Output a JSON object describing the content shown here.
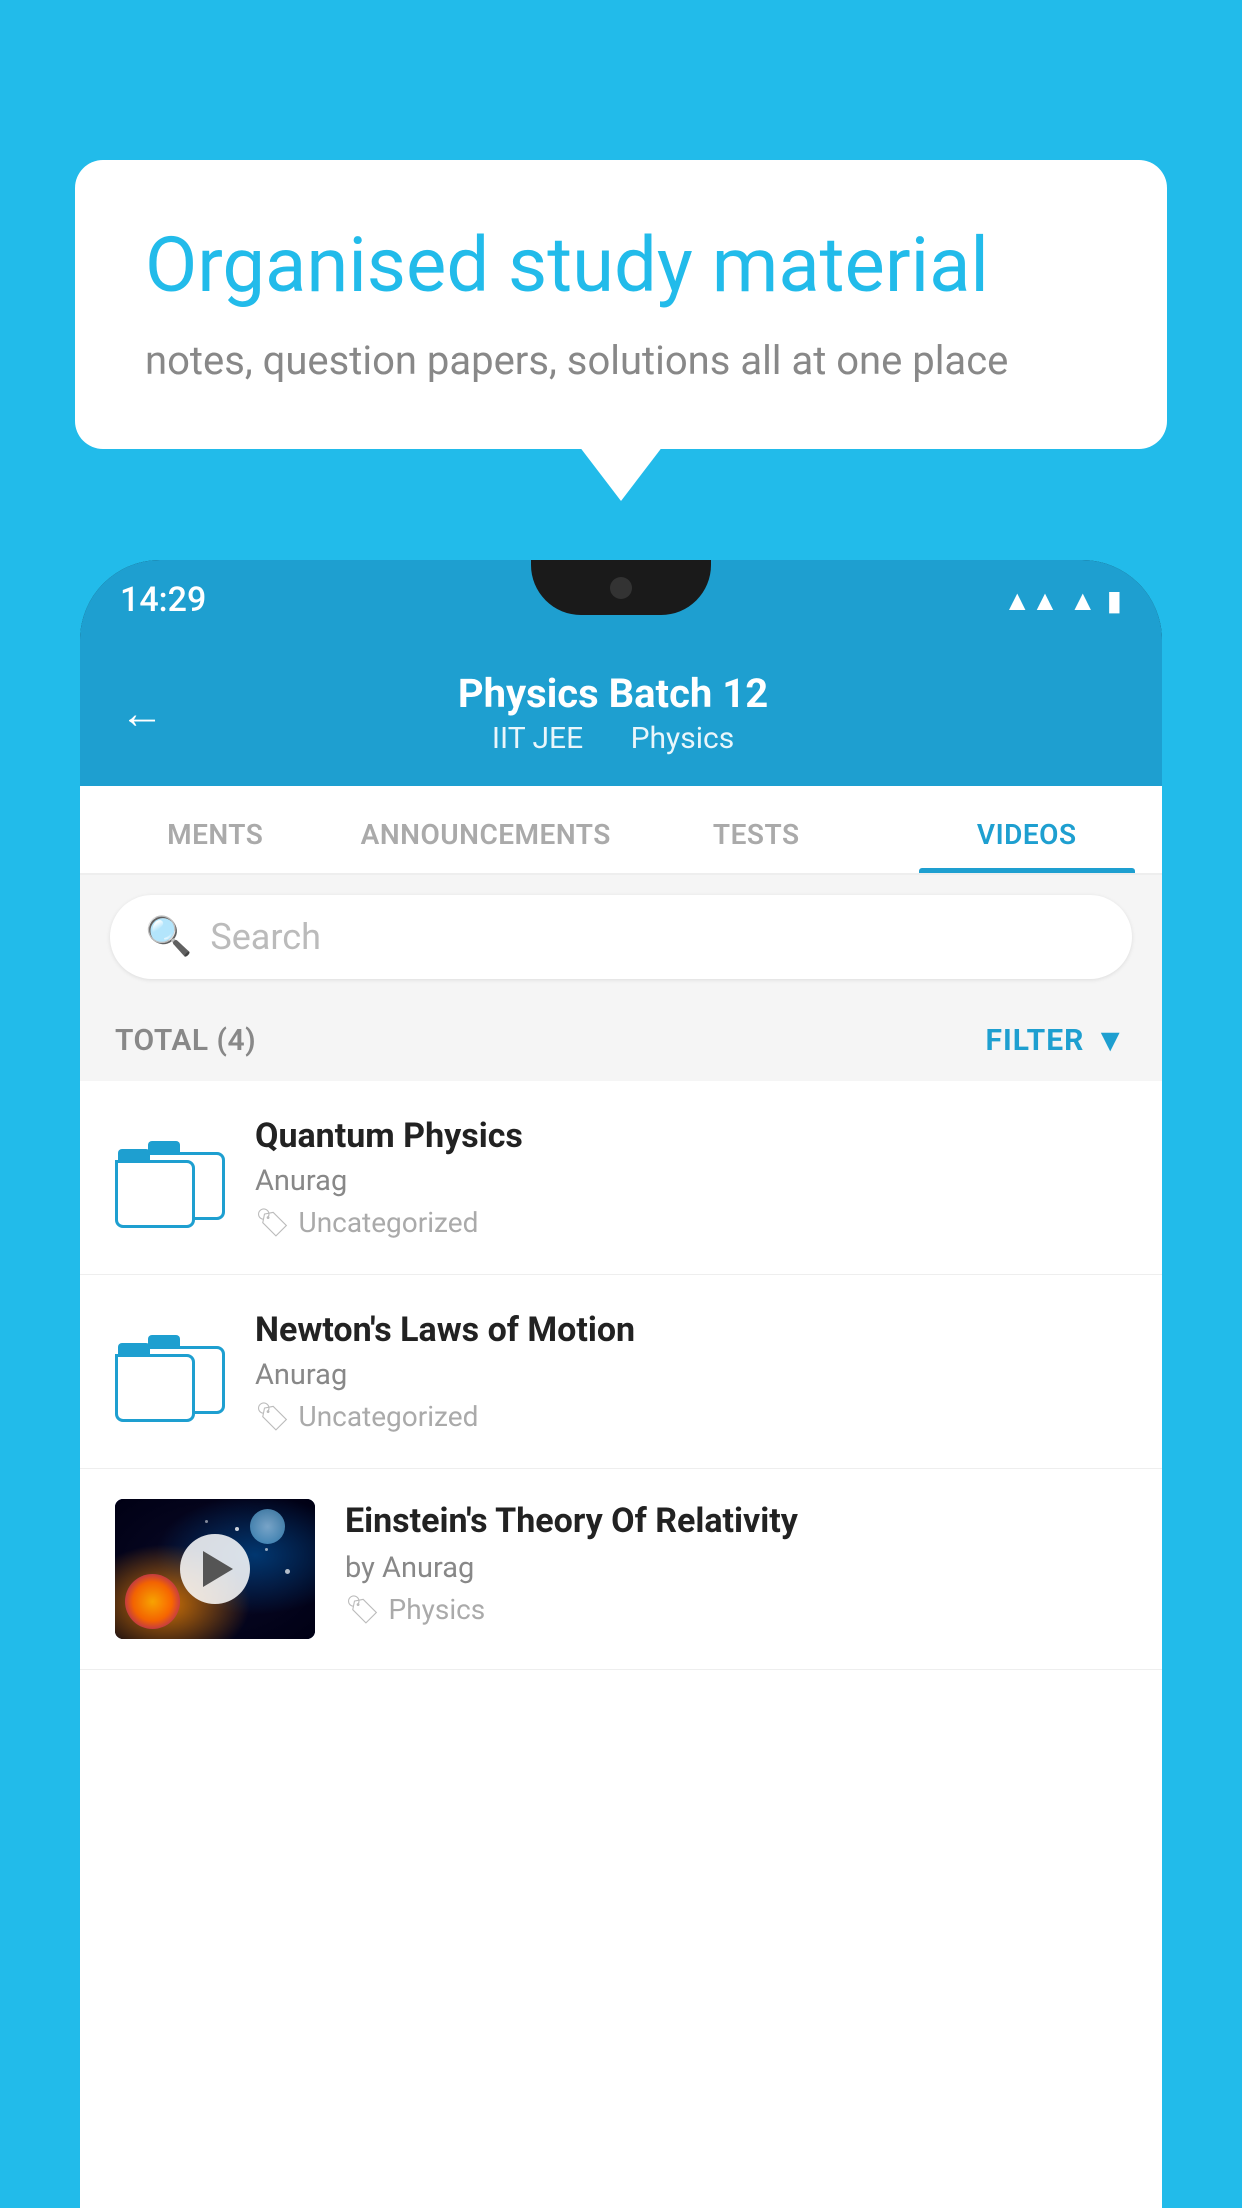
{
  "background_color": "#22BBEA",
  "speech_bubble": {
    "headline": "Organised study material",
    "subtext": "notes, question papers, solutions all at one place"
  },
  "status_bar": {
    "time": "14:29",
    "icons": [
      "wifi",
      "signal",
      "battery"
    ]
  },
  "app_header": {
    "back_label": "←",
    "title": "Physics Batch 12",
    "subtitle_part1": "IIT JEE",
    "subtitle_part2": "Physics"
  },
  "tabs": [
    {
      "id": "ments",
      "label": "MENTS",
      "active": false
    },
    {
      "id": "announcements",
      "label": "ANNOUNCEMENTS",
      "active": false
    },
    {
      "id": "tests",
      "label": "TESTS",
      "active": false
    },
    {
      "id": "videos",
      "label": "VIDEOS",
      "active": true
    }
  ],
  "search": {
    "placeholder": "Search"
  },
  "filter_bar": {
    "total_label": "TOTAL (4)",
    "filter_label": "FILTER"
  },
  "videos": [
    {
      "id": "quantum",
      "title": "Quantum Physics",
      "author": "Anurag",
      "tag": "Uncategorized",
      "has_thumbnail": false
    },
    {
      "id": "newton",
      "title": "Newton's Laws of Motion",
      "author": "Anurag",
      "tag": "Uncategorized",
      "has_thumbnail": false
    },
    {
      "id": "einstein",
      "title": "Einstein's Theory Of Relativity",
      "author": "by Anurag",
      "tag": "Physics",
      "has_thumbnail": true
    }
  ]
}
